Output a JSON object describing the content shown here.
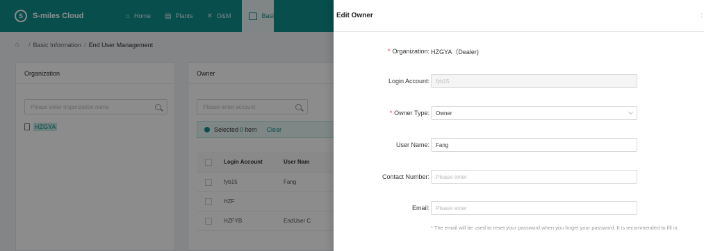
{
  "app": {
    "logo_mark": "S",
    "logo_text": "S-miles Cloud",
    "nav": [
      {
        "icon": "⌂",
        "label": "Home"
      },
      {
        "icon": "▤",
        "label": "Plants"
      },
      {
        "icon": "✕",
        "label": "O&M"
      },
      {
        "icon": "",
        "label": "Basi"
      }
    ],
    "breadcrumb": {
      "home_icon": "⌂",
      "sep": "/",
      "items": [
        "Basic Information",
        "End User Management"
      ]
    },
    "org_panel": {
      "title": "Organization",
      "search_placeholder": "Please enter organization name",
      "tree_item": "HZGYA"
    },
    "owner_panel": {
      "title": "Owner",
      "search_placeholder": "Please enter account",
      "selected_prefix": "Selected",
      "selected_count": "0",
      "selected_suffix": "Item",
      "clear_label": "Clear",
      "columns": [
        "Login Account",
        "User Nam"
      ],
      "rows": [
        {
          "account": "fyb15",
          "user": "Fang"
        },
        {
          "account": "HZF",
          "user": ""
        },
        {
          "account": "HZFYB",
          "user": "EndUser C"
        }
      ]
    }
  },
  "drawer": {
    "title": "Edit Owner",
    "close_icon": ":",
    "required_mark": "*",
    "fields": {
      "organization": {
        "label": "Organization:",
        "value": "HZGYA（Dealer)"
      },
      "login_account": {
        "label": "Login Account:",
        "value": "fyb15"
      },
      "owner_type": {
        "label": "Owner Type:",
        "value": "Owner"
      },
      "user_name": {
        "label": "User Name:",
        "value": "Fang"
      },
      "contact_number": {
        "label": "Contact Number:",
        "placeholder": "Please enter"
      },
      "email": {
        "label": "Email:",
        "placeholder": "Please enter"
      }
    },
    "hint": "* The email will be used to reset your password when you forget your password. It is recommended to fill in."
  }
}
